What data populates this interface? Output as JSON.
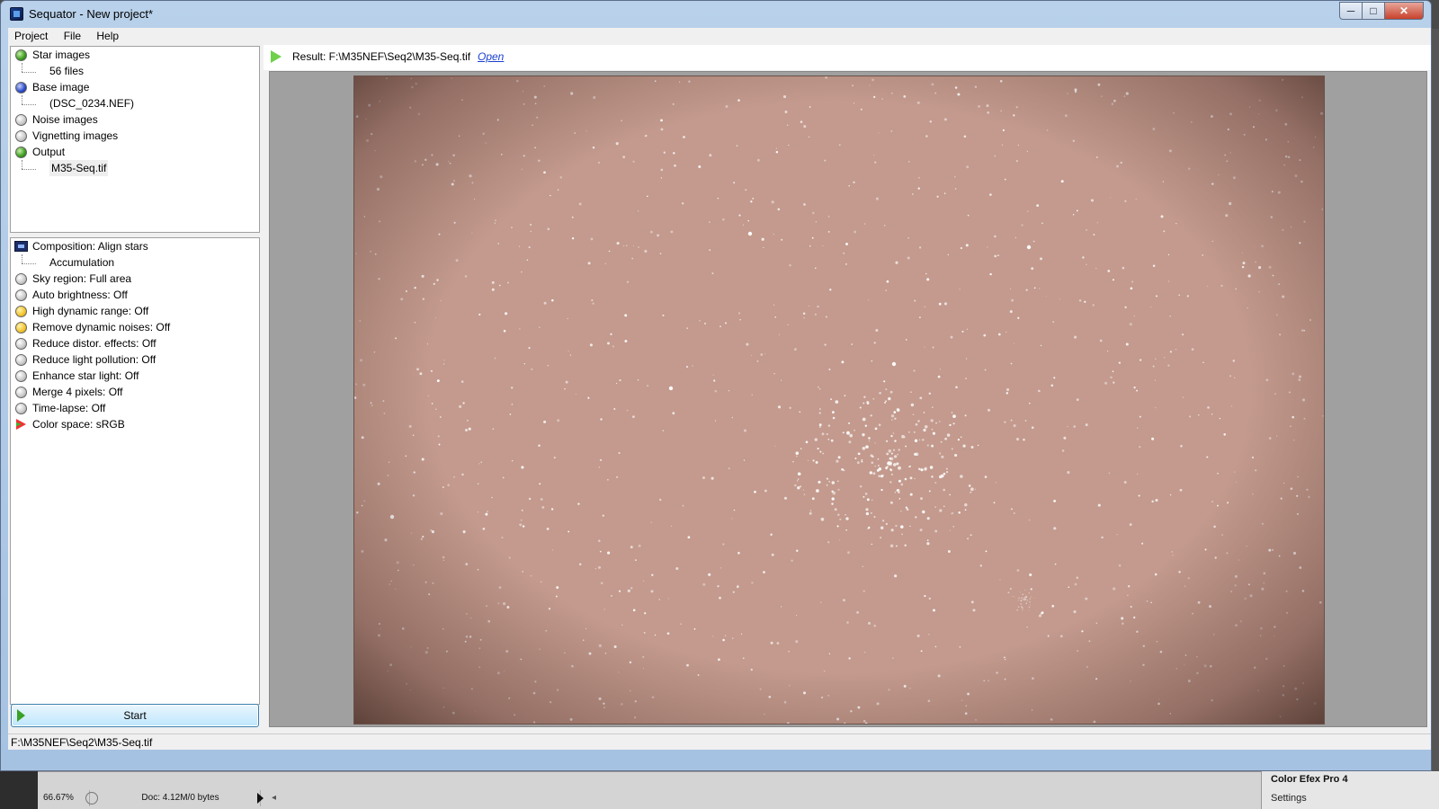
{
  "window": {
    "title": "Sequator - New project*",
    "min": "─",
    "max": "□",
    "close": "✕"
  },
  "menu": [
    "Project",
    "File",
    "Help"
  ],
  "inputs_panel": {
    "items": [
      {
        "label": "Star images",
        "dot": "green"
      },
      {
        "label": "56 files",
        "child": true
      },
      {
        "label": "Base image",
        "dot": "blue"
      },
      {
        "label": "(DSC_0234.NEF)",
        "child": true
      },
      {
        "label": "Noise images",
        "dot": "gray"
      },
      {
        "label": "Vignetting images",
        "dot": "gray"
      },
      {
        "label": "Output",
        "dot": "green"
      },
      {
        "label": "M35-Seq.tif",
        "child": true,
        "selected": true
      }
    ]
  },
  "settings_panel": {
    "items": [
      {
        "label": "Composition: Align stars",
        "icon": "composition"
      },
      {
        "label": "Accumulation",
        "child": true
      },
      {
        "label": "Sky region: Full area",
        "dot": "gray"
      },
      {
        "label": "Auto brightness: Off",
        "dot": "gray"
      },
      {
        "label": "High dynamic range: Off",
        "dot": "yellow"
      },
      {
        "label": "Remove dynamic noises: Off",
        "dot": "yellow"
      },
      {
        "label": "Reduce distor. effects: Off",
        "dot": "gray"
      },
      {
        "label": "Reduce light pollution: Off",
        "dot": "gray"
      },
      {
        "label": "Enhance star light: Off",
        "dot": "gray"
      },
      {
        "label": "Merge 4 pixels: Off",
        "dot": "gray"
      },
      {
        "label": "Time-lapse: Off",
        "dot": "gray"
      },
      {
        "label": "Color space: sRGB",
        "icon": "colorspace"
      }
    ]
  },
  "start_button": "Start",
  "result": {
    "text": "Result: F:\\M35NEF\\Seq2\\M35-Seq.tif",
    "open_link": "Open"
  },
  "status_path": "F:\\M35NEF\\Seq2\\M35-Seq.tif",
  "background_app": {
    "zoom": "66.67%",
    "doc": "Doc: 4.12M/0 bytes",
    "panel_title": "Color Efex Pro 4",
    "panel_settings": "Settings"
  }
}
